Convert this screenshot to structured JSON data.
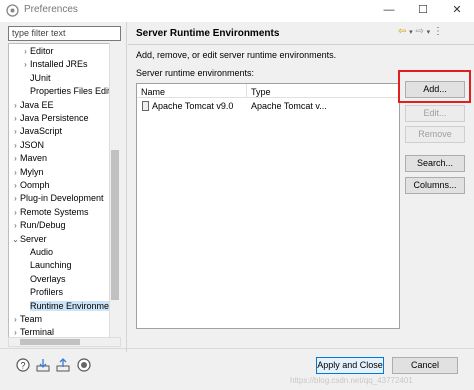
{
  "window": {
    "title": "Preferences",
    "minimize_glyph": "—",
    "maximize_glyph": "☐",
    "close_glyph": "✕"
  },
  "sidebar": {
    "filter_placeholder": "type filter text",
    "items": [
      {
        "label": "Editor",
        "expander": "›"
      },
      {
        "label": "Installed JREs",
        "expander": "›"
      },
      {
        "label": "JUnit",
        "expander": ""
      },
      {
        "label": "Properties Files Editor",
        "expander": ""
      },
      {
        "label": "Java EE",
        "expander": "›"
      },
      {
        "label": "Java Persistence",
        "expander": "›"
      },
      {
        "label": "JavaScript",
        "expander": "›"
      },
      {
        "label": "JSON",
        "expander": "›"
      },
      {
        "label": "Maven",
        "expander": "›"
      },
      {
        "label": "Mylyn",
        "expander": "›"
      },
      {
        "label": "Oomph",
        "expander": "›"
      },
      {
        "label": "Plug-in Development",
        "expander": "›"
      },
      {
        "label": "Remote Systems",
        "expander": "›"
      },
      {
        "label": "Run/Debug",
        "expander": "›"
      },
      {
        "label": "Server",
        "expander": "⌄"
      },
      {
        "label": "Audio",
        "expander": ""
      },
      {
        "label": "Launching",
        "expander": ""
      },
      {
        "label": "Overlays",
        "expander": ""
      },
      {
        "label": "Profilers",
        "expander": ""
      },
      {
        "label": "Runtime Environments",
        "expander": ""
      },
      {
        "label": "Team",
        "expander": "›"
      },
      {
        "label": "Terminal",
        "expander": "›"
      }
    ],
    "selected": "Runtime Environments"
  },
  "page": {
    "title": "Server Runtime Environments",
    "nav_back": "⇦",
    "nav_forward": "⇨",
    "nav_menu": "⋮",
    "description": "Add, remove, or edit server runtime environments.",
    "list_label": "Server runtime environments:",
    "columns": [
      "Name",
      "Type"
    ],
    "rows": [
      {
        "name": "Apache Tomcat v9.0",
        "type": "Apache Tomcat v..."
      }
    ]
  },
  "buttons": {
    "add": "Add...",
    "edit": "Edit...",
    "remove": "Remove",
    "search": "Search...",
    "columns": "Columns..."
  },
  "footer": {
    "apply_close": "Apply and Close",
    "cancel": "Cancel",
    "watermark": "https://blog.csdn.net/qq_43772401"
  },
  "colors": {
    "highlight": "#e02020",
    "selection": "#cce4f7",
    "primary_border": "#0078d7"
  },
  "icons": [
    "app-icon",
    "help-icon",
    "import-icon",
    "export-icon",
    "record-icon"
  ]
}
